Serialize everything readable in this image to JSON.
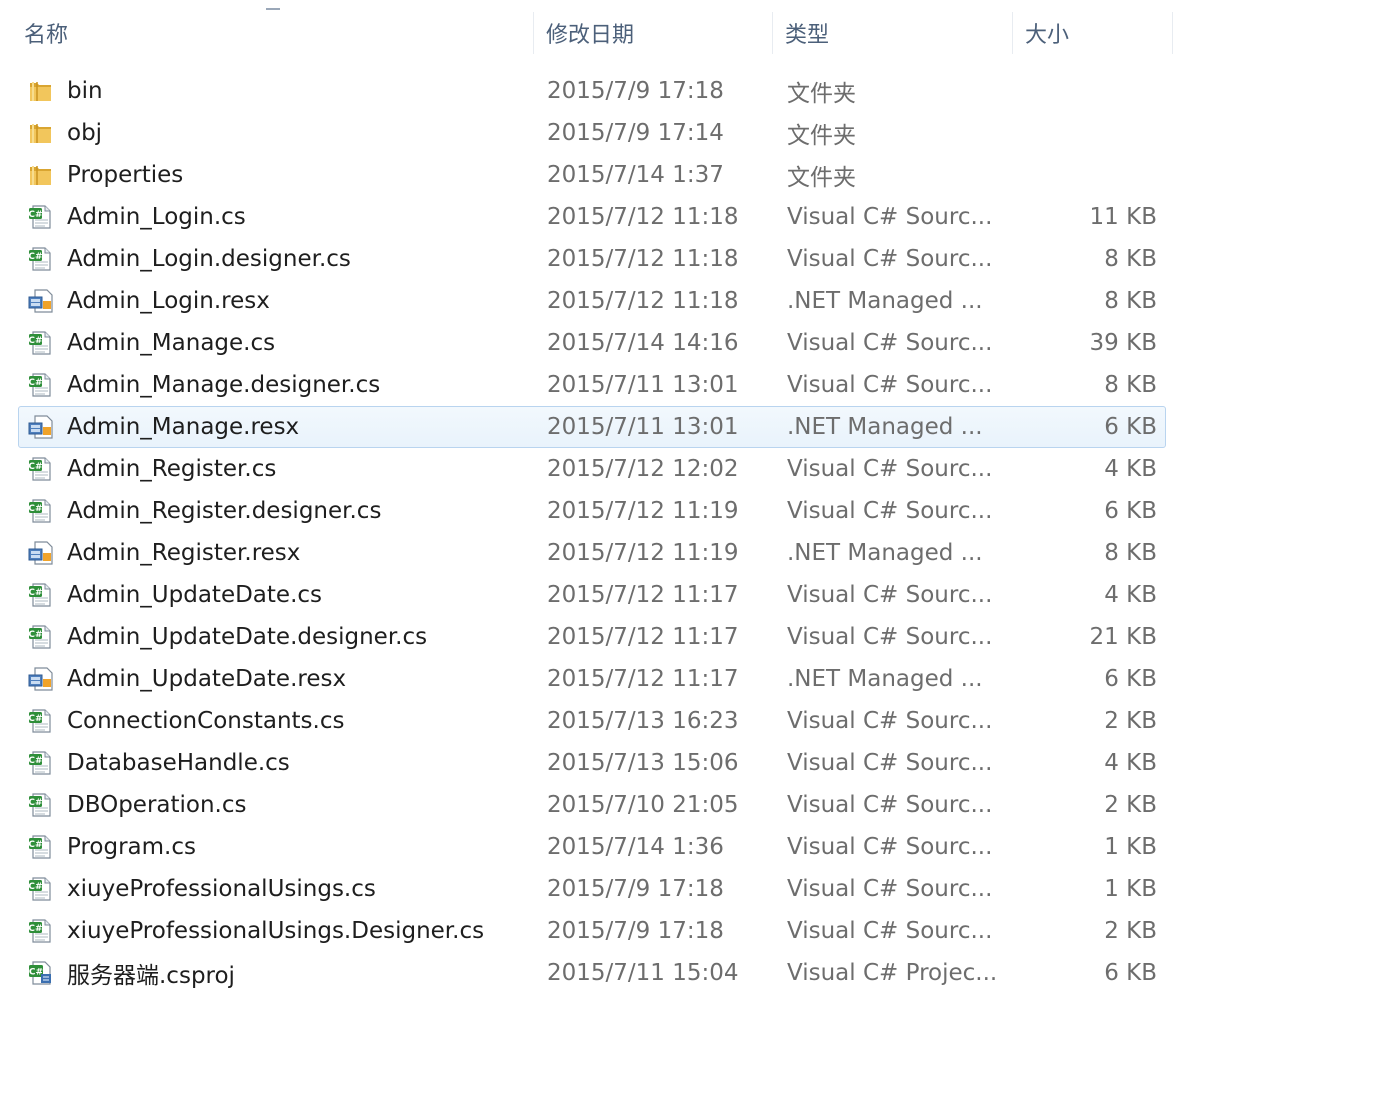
{
  "columns": {
    "name": "名称",
    "date": "修改日期",
    "type": "类型",
    "size": "大小"
  },
  "colors": {
    "header_text": "#4c607a",
    "selection_bg": "#e9f3fc",
    "selection_border": "#b9d4ef",
    "folder": "#e8b64a"
  },
  "files": [
    {
      "icon": "folder-icon",
      "name": "bin",
      "date": "2015/7/9 17:18",
      "type": "文件夹",
      "size": ""
    },
    {
      "icon": "folder-icon",
      "name": "obj",
      "date": "2015/7/9 17:14",
      "type": "文件夹",
      "size": ""
    },
    {
      "icon": "folder-icon",
      "name": "Properties",
      "date": "2015/7/14 1:37",
      "type": "文件夹",
      "size": ""
    },
    {
      "icon": "csharp-file-icon",
      "name": "Admin_Login.cs",
      "date": "2015/7/12 11:18",
      "type": "Visual C# Sourc...",
      "size": "11 KB"
    },
    {
      "icon": "csharp-file-icon",
      "name": "Admin_Login.designer.cs",
      "date": "2015/7/12 11:18",
      "type": "Visual C# Sourc...",
      "size": "8 KB"
    },
    {
      "icon": "resx-file-icon",
      "name": "Admin_Login.resx",
      "date": "2015/7/12 11:18",
      "type": ".NET Managed ...",
      "size": "8 KB"
    },
    {
      "icon": "csharp-file-icon",
      "name": "Admin_Manage.cs",
      "date": "2015/7/14 14:16",
      "type": "Visual C# Sourc...",
      "size": "39 KB"
    },
    {
      "icon": "csharp-file-icon",
      "name": "Admin_Manage.designer.cs",
      "date": "2015/7/11 13:01",
      "type": "Visual C# Sourc...",
      "size": "8 KB"
    },
    {
      "icon": "resx-file-icon",
      "name": "Admin_Manage.resx",
      "date": "2015/7/11 13:01",
      "type": ".NET Managed ...",
      "size": "6 KB",
      "selected": true
    },
    {
      "icon": "csharp-file-icon",
      "name": "Admin_Register.cs",
      "date": "2015/7/12 12:02",
      "type": "Visual C# Sourc...",
      "size": "4 KB"
    },
    {
      "icon": "csharp-file-icon",
      "name": "Admin_Register.designer.cs",
      "date": "2015/7/12 11:19",
      "type": "Visual C# Sourc...",
      "size": "6 KB"
    },
    {
      "icon": "resx-file-icon",
      "name": "Admin_Register.resx",
      "date": "2015/7/12 11:19",
      "type": ".NET Managed ...",
      "size": "8 KB"
    },
    {
      "icon": "csharp-file-icon",
      "name": "Admin_UpdateDate.cs",
      "date": "2015/7/12 11:17",
      "type": "Visual C# Sourc...",
      "size": "4 KB"
    },
    {
      "icon": "csharp-file-icon",
      "name": "Admin_UpdateDate.designer.cs",
      "date": "2015/7/12 11:17",
      "type": "Visual C# Sourc...",
      "size": "21 KB"
    },
    {
      "icon": "resx-file-icon",
      "name": "Admin_UpdateDate.resx",
      "date": "2015/7/12 11:17",
      "type": ".NET Managed ...",
      "size": "6 KB"
    },
    {
      "icon": "csharp-file-icon",
      "name": "ConnectionConstants.cs",
      "date": "2015/7/13 16:23",
      "type": "Visual C# Sourc...",
      "size": "2 KB"
    },
    {
      "icon": "csharp-file-icon",
      "name": "DatabaseHandle.cs",
      "date": "2015/7/13 15:06",
      "type": "Visual C# Sourc...",
      "size": "4 KB"
    },
    {
      "icon": "csharp-file-icon",
      "name": "DBOperation.cs",
      "date": "2015/7/10 21:05",
      "type": "Visual C# Sourc...",
      "size": "2 KB"
    },
    {
      "icon": "csharp-file-icon",
      "name": "Program.cs",
      "date": "2015/7/14 1:36",
      "type": "Visual C# Sourc...",
      "size": "1 KB"
    },
    {
      "icon": "csharp-file-icon",
      "name": "xiuyeProfessionalUsings.cs",
      "date": "2015/7/9 17:18",
      "type": "Visual C# Sourc...",
      "size": "1 KB"
    },
    {
      "icon": "csharp-file-icon",
      "name": "xiuyeProfessionalUsings.Designer.cs",
      "date": "2015/7/9 17:18",
      "type": "Visual C# Sourc...",
      "size": "2 KB"
    },
    {
      "icon": "csproj-file-icon",
      "name": "服务器端.csproj",
      "date": "2015/7/11 15:04",
      "type": "Visual C# Projec...",
      "size": "6 KB"
    }
  ]
}
